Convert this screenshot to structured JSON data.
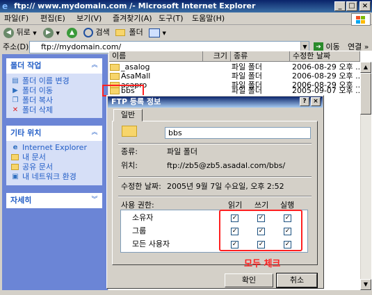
{
  "window": {
    "title": "ftp:// www.mydomain.com /- Microsoft Internet Explorer",
    "minimize": "_",
    "maximize": "□",
    "close": "×"
  },
  "menu": [
    "파일(F)",
    "편집(E)",
    "보기(V)",
    "즐겨찾기(A)",
    "도구(T)",
    "도움말(H)"
  ],
  "toolbar": {
    "back": "뒤로",
    "search": "검색",
    "folders": "폴더"
  },
  "address": {
    "label": "주소(D)",
    "value": "ftp://mydomain.com/",
    "go": "이동",
    "links": "연결"
  },
  "tasks": {
    "folder_tasks": {
      "title": "폴더 작업",
      "items": [
        "폴더 이름 변경",
        "폴더 이동",
        "폴더 복사",
        "폴더 삭제"
      ]
    },
    "other_places": {
      "title": "기타 위치",
      "items": [
        "Internet Explorer",
        "내 문서",
        "공유 문서",
        "내 네트워크 환경"
      ]
    },
    "details": {
      "title": "자세히"
    }
  },
  "filelist": {
    "columns": [
      "이름",
      "크기",
      "종류",
      "수정한 날짜"
    ],
    "rows": [
      {
        "name": "_asalog",
        "type": "파일 폴더",
        "date": "2006-08-29 오후 ..."
      },
      {
        "name": "AsaMall",
        "type": "파일 폴더",
        "date": "2006-08-29 오후 ..."
      },
      {
        "name": "asapro",
        "type": "파일 폴더",
        "date": "2006-08-29 오후 ..."
      },
      {
        "name": "bbs",
        "type": "파일 폴더",
        "date": "2005-09-07 오후 ..."
      }
    ]
  },
  "dialog": {
    "title": "FTP 등록 정보",
    "tab": "일반",
    "name": "bbs",
    "type_label": "종류:",
    "type_value": "파일 폴더",
    "location_label": "위치:",
    "location_value": "ftp://zb5@zb5.asadal.com/bbs/",
    "modified_label": "수정한 날짜:",
    "modified_value": "2005년 9월 7일 수요일, 오후 2:52",
    "perm_label": "사용 권한:",
    "perm_columns": [
      "읽기",
      "쓰기",
      "실행"
    ],
    "perm_rows": [
      "소유자",
      "그룹",
      "모든 사용자"
    ],
    "ok": "확인",
    "cancel": "취소",
    "help": "?",
    "close": "×"
  },
  "annotation": "모두 체크"
}
